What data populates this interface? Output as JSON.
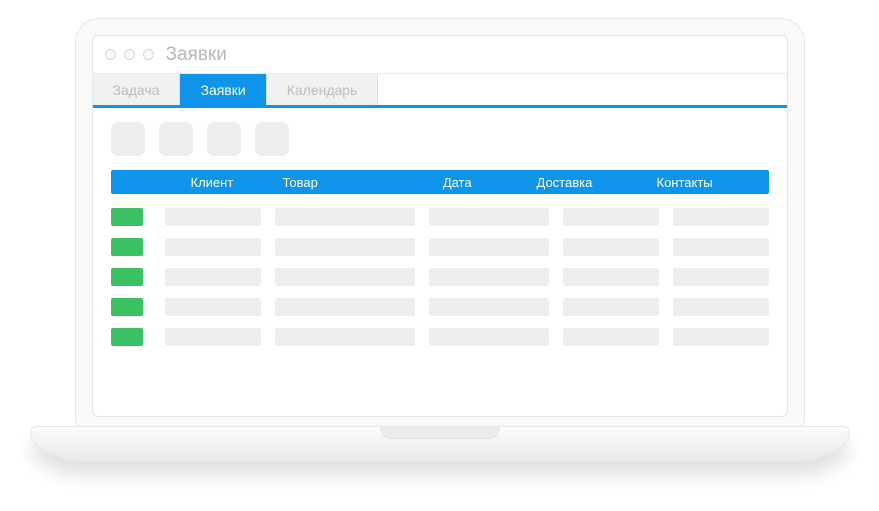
{
  "window": {
    "title": "Заявки"
  },
  "tabs": [
    {
      "label": "Задача",
      "active": false
    },
    {
      "label": "Заявки",
      "active": true
    },
    {
      "label": "Календарь",
      "active": false
    }
  ],
  "table": {
    "columns": {
      "client": "Клиент",
      "product": "Товар",
      "date": "Дата",
      "delivery": "Доставка",
      "contacts": "Контакты"
    },
    "row_count": 5
  },
  "colors": {
    "accent": "#0e94ea",
    "status_ok": "#3bc163",
    "placeholder": "#ededed"
  }
}
